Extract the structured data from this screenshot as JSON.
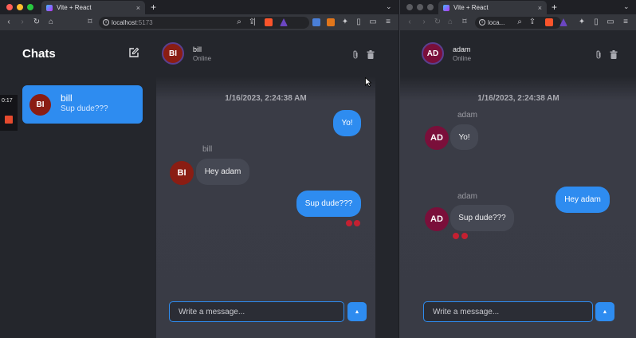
{
  "colors": {
    "accent": "#2e8cf0",
    "bill_avatar": "#8a1d13",
    "adam_avatar": "#7a0f3a",
    "reaction": "#c42031",
    "record_stop": "#e64a2e"
  },
  "left_window": {
    "tab_title": "Vite + React",
    "url": {
      "host": "localhost",
      "port": ":5173"
    },
    "sidebar": {
      "title": "Chats",
      "recording_time": "0:17",
      "conversation": {
        "initials": "BI",
        "name": "bill",
        "preview": "Sup dude???"
      }
    },
    "chat": {
      "header": {
        "initials": "BI",
        "name": "bill",
        "status": "Online"
      },
      "timestamp": "1/16/2023, 2:24:38 AM",
      "messages": [
        {
          "text": "Yo!"
        },
        {
          "sender": "bill",
          "initials": "BI",
          "text": "Hey adam"
        },
        {
          "text": "Sup dude???"
        }
      ],
      "input_placeholder": "Write a message...",
      "send_icon": "caret-up-icon"
    }
  },
  "right_window": {
    "tab_title": "Vite + React",
    "url": {
      "host": "loca..."
    },
    "chat": {
      "header": {
        "initials": "AD",
        "name": "adam",
        "status": "Online"
      },
      "timestamp": "1/16/2023, 2:24:38 AM",
      "messages": [
        {
          "sender": "adam",
          "initials": "AD",
          "text": "Yo!"
        },
        {
          "text": "Hey adam"
        },
        {
          "sender": "adam",
          "initials": "AD",
          "text": "Sup dude???"
        }
      ],
      "input_placeholder": "Write a message...",
      "send_icon": "caret-up-icon"
    }
  }
}
